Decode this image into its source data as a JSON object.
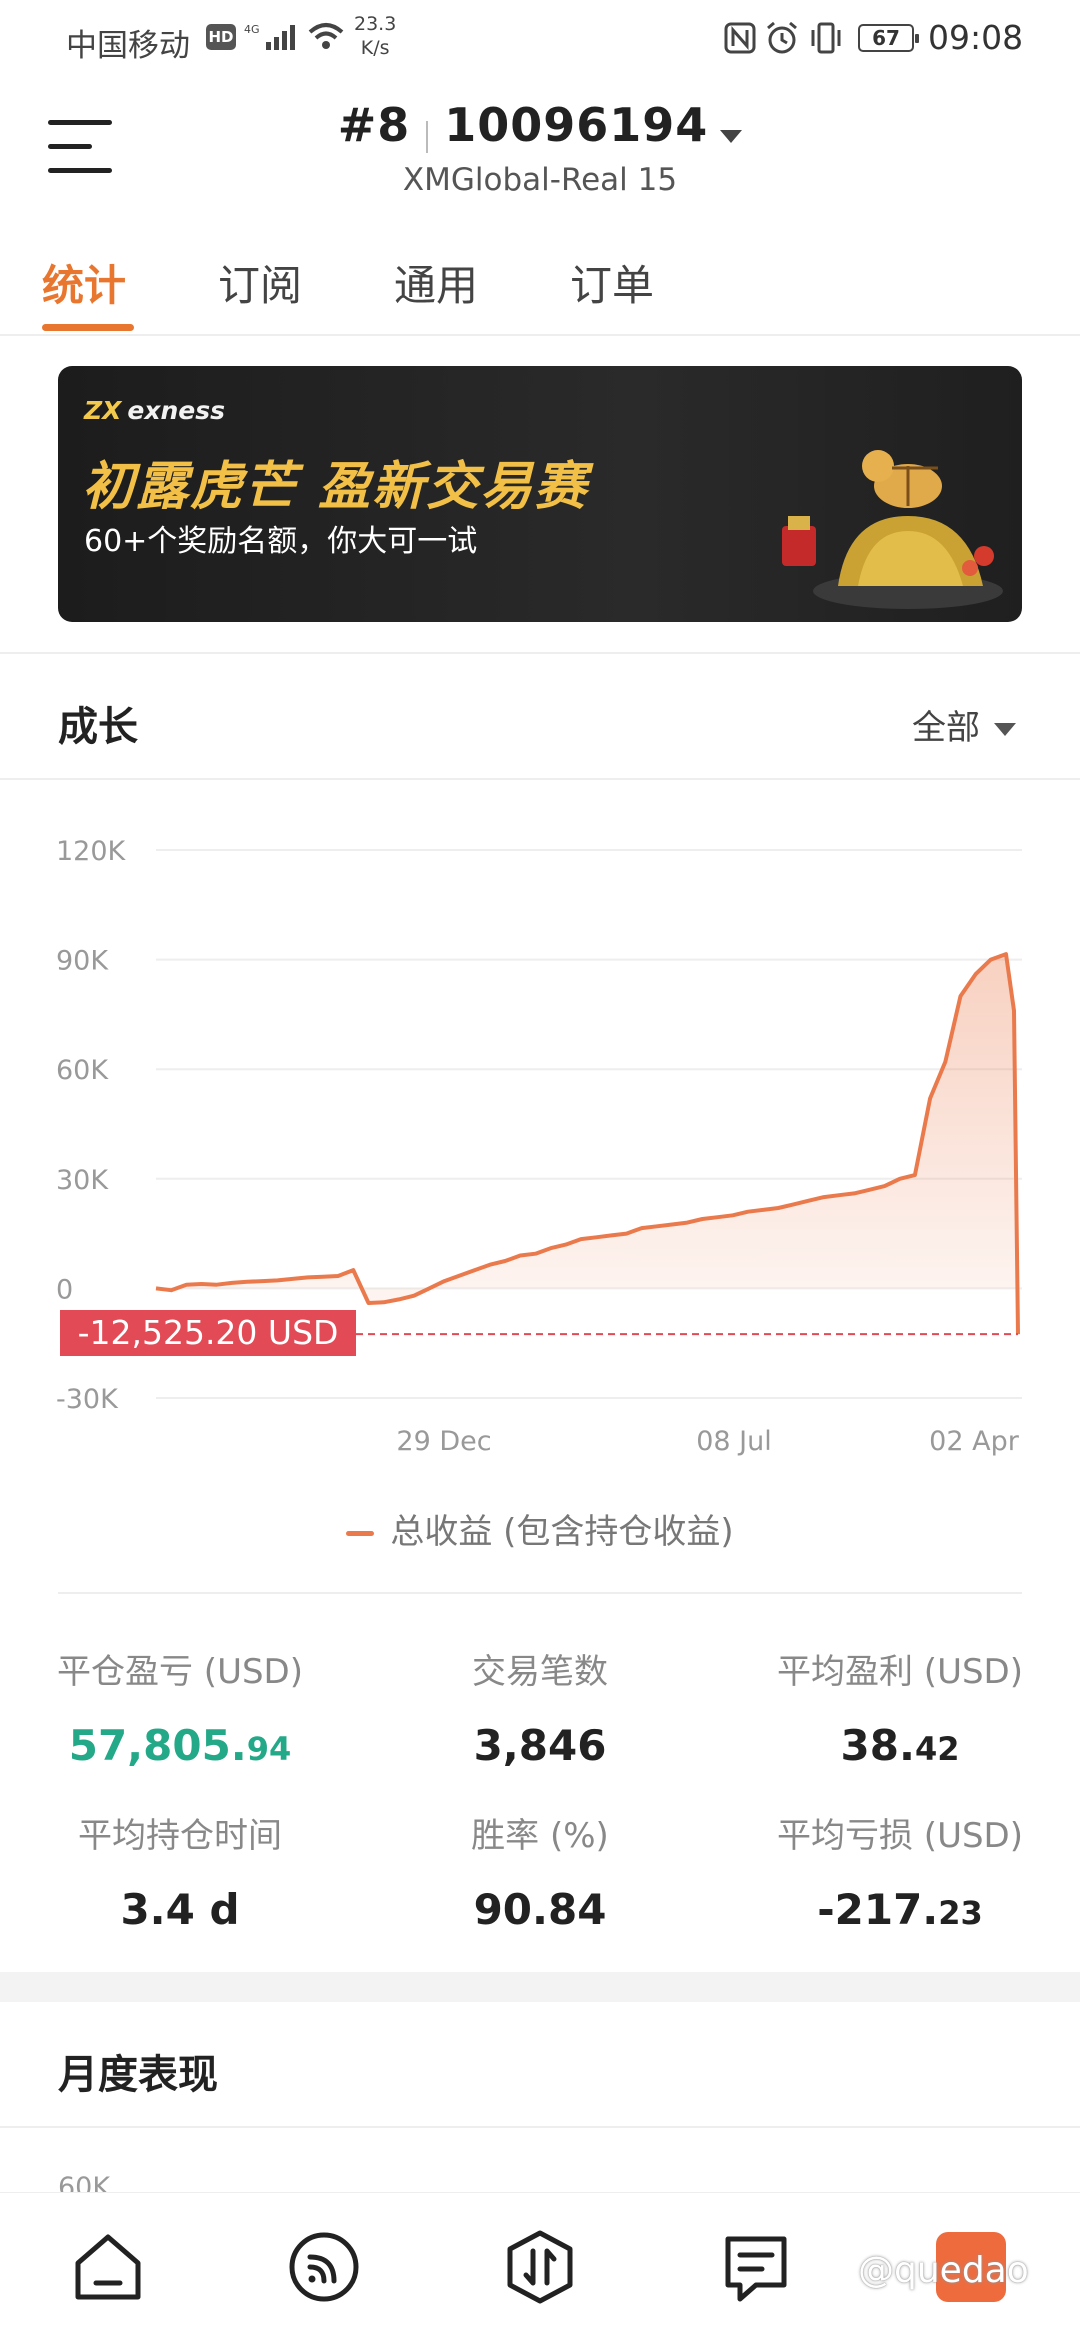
{
  "status_bar": {
    "carrier": "中国移动",
    "hd": "HD",
    "network": "4G",
    "speed_value": "23.3",
    "speed_unit": "K/s",
    "battery": "67",
    "time": "09:08"
  },
  "header": {
    "account_rank": "#8",
    "account_id": "10096194",
    "server": "XMGlobal-Real 15"
  },
  "tabs": [
    {
      "label": "统计",
      "active": true
    },
    {
      "label": "订阅",
      "active": false
    },
    {
      "label": "通用",
      "active": false
    },
    {
      "label": "订单",
      "active": false
    }
  ],
  "banner": {
    "brand": "exness",
    "headline": "初露虎芒 盈新交易赛",
    "subtitle": "60+个奖励名额，你大可一试"
  },
  "growth": {
    "title": "成长",
    "filter": "全部",
    "current_value_label": "-12,525.20 USD",
    "legend": "总收益 (包含持仓收益)"
  },
  "chart_data": {
    "type": "area",
    "y_ticks": [
      "120K",
      "90K",
      "60K",
      "30K",
      "0",
      "-30K"
    ],
    "y_tick_values": [
      120000,
      90000,
      60000,
      30000,
      0,
      -30000
    ],
    "ylim": [
      -30000,
      120000
    ],
    "x_ticks": [
      "29 Dec",
      "08 Jul",
      "02 Apr"
    ],
    "series": [
      {
        "name": "总收益 (包含持仓收益)",
        "values": [
          0,
          -500,
          1000,
          1200,
          1000,
          1500,
          1800,
          2000,
          2200,
          2600,
          3000,
          3200,
          3400,
          5000,
          -4000,
          -3800,
          -3000,
          -2000,
          0,
          2000,
          3500,
          5000,
          6500,
          7500,
          9000,
          9500,
          11000,
          12000,
          13500,
          14000,
          14500,
          15000,
          16500,
          17000,
          17500,
          18000,
          19000,
          19500,
          20000,
          21000,
          21500,
          22000,
          23000,
          24000,
          25000,
          25500,
          26000,
          27000,
          28000,
          30000,
          31000,
          52000,
          62000,
          80000,
          86000,
          90000,
          91500,
          76000,
          -12525.2
        ],
        "color": "#ea7a4c"
      }
    ],
    "reference_line": -12525.2,
    "grid": true
  },
  "stats": [
    {
      "label": "平仓盈亏 (USD)",
      "value_main": "57,805.",
      "value_dec": "94",
      "color": "green"
    },
    {
      "label": "交易笔数",
      "value_main": "3,846",
      "value_dec": "",
      "color": "default"
    },
    {
      "label": "平均盈利 (USD)",
      "value_main": "38.",
      "value_dec": "42",
      "color": "default"
    },
    {
      "label": "平均持仓时间",
      "value_main": "3.4 d",
      "value_dec": "",
      "color": "default"
    },
    {
      "label": "胜率 (%)",
      "value_main": "90.84",
      "value_dec": "",
      "color": "default"
    },
    {
      "label": "平均亏损 (USD)",
      "value_main": "-217.",
      "value_dec": "23",
      "color": "default"
    }
  ],
  "monthly": {
    "title": "月度表现",
    "first_tick": "60K"
  },
  "watermark": "@quedao",
  "colors": {
    "accent": "#e8762e",
    "line": "#ea7a4c",
    "negative": "#e24a55",
    "positive": "#24a988"
  }
}
